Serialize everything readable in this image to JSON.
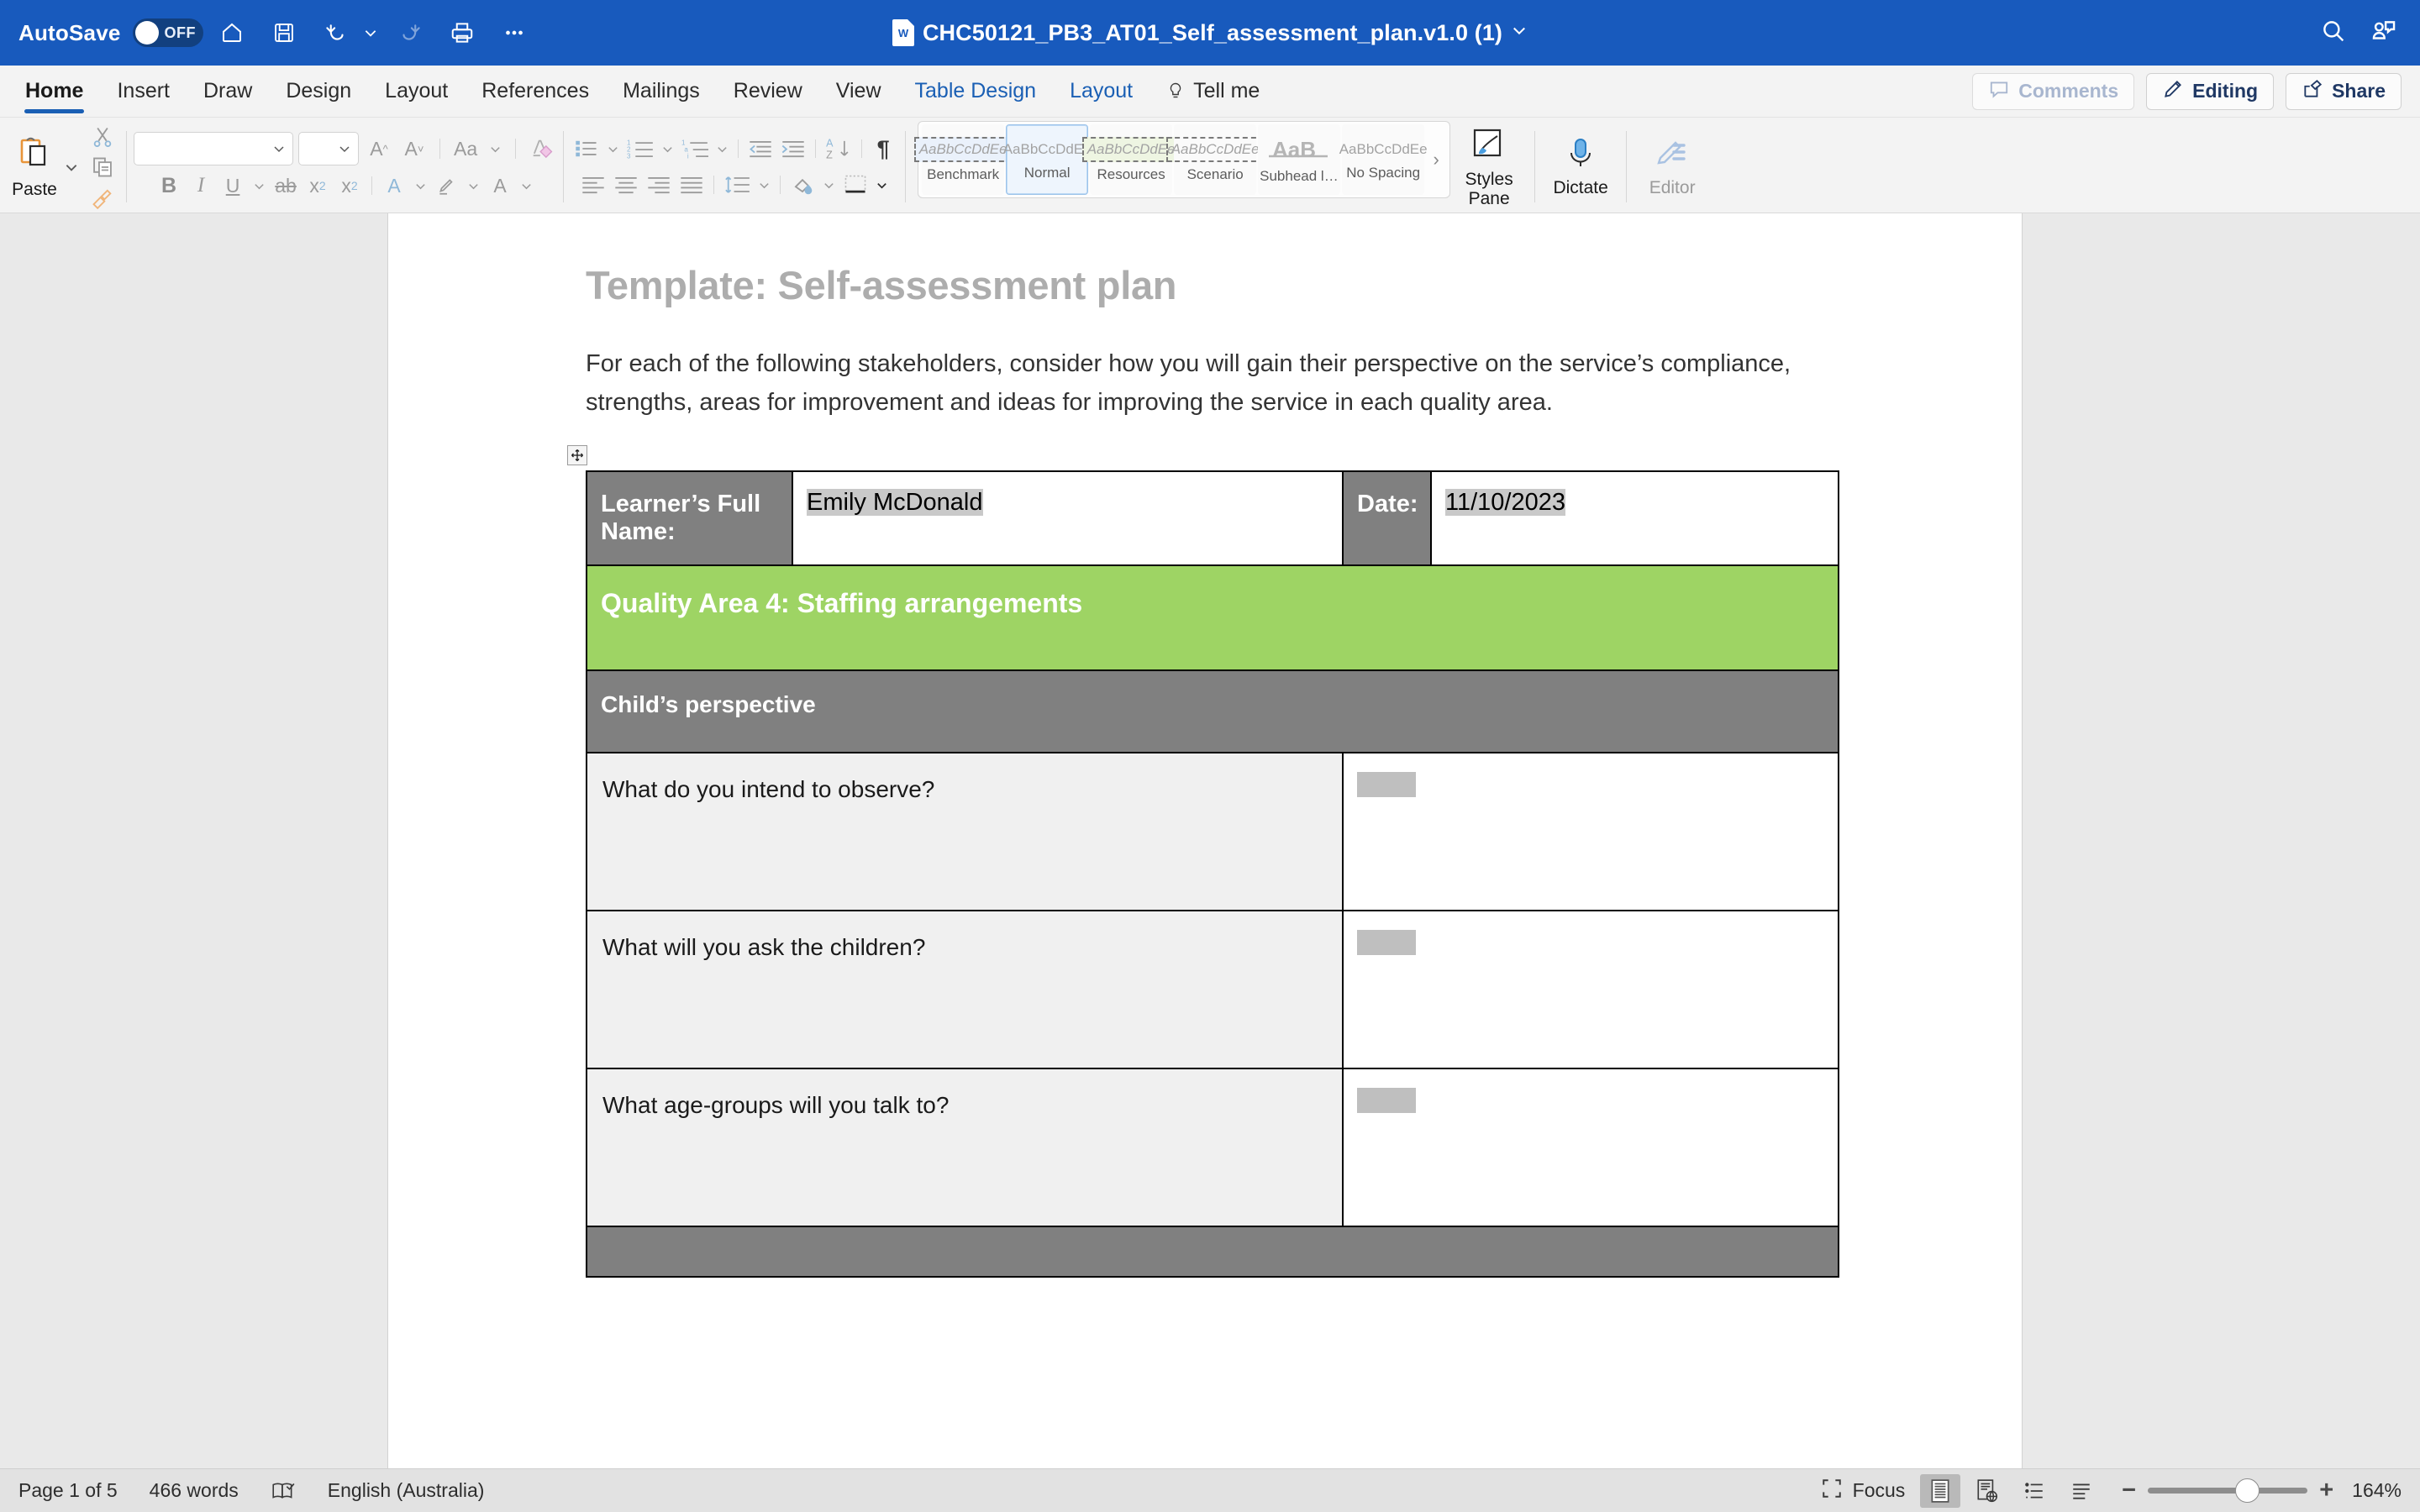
{
  "titlebar": {
    "autosave_label": "AutoSave",
    "autosave_state": "OFF",
    "document_title": "CHC50121_PB3_AT01_Self_assessment_plan.v1.0 (1)",
    "quick_access": [
      {
        "name": "home-icon",
        "label": "Home"
      },
      {
        "name": "save-icon",
        "label": "Save"
      },
      {
        "name": "undo-icon",
        "label": "Undo"
      },
      {
        "name": "undo-dropdown-caret-icon",
        "label": "Undo options"
      },
      {
        "name": "redo-icon",
        "label": "Redo"
      },
      {
        "name": "print-icon",
        "label": "Print"
      },
      {
        "name": "more-commands-icon",
        "label": "More"
      }
    ],
    "right_icons": [
      {
        "name": "search-icon",
        "label": "Search"
      },
      {
        "name": "collaborators-icon",
        "label": "Collaborators"
      }
    ],
    "title_dropdown_caret": "∨",
    "doc_icon_letter": "W"
  },
  "ribbon": {
    "tabs": [
      {
        "label": "Home",
        "active": true,
        "contextual": false
      },
      {
        "label": "Insert",
        "active": false,
        "contextual": false
      },
      {
        "label": "Draw",
        "active": false,
        "contextual": false
      },
      {
        "label": "Design",
        "active": false,
        "contextual": false
      },
      {
        "label": "Layout",
        "active": false,
        "contextual": false
      },
      {
        "label": "References",
        "active": false,
        "contextual": false
      },
      {
        "label": "Mailings",
        "active": false,
        "contextual": false
      },
      {
        "label": "Review",
        "active": false,
        "contextual": false
      },
      {
        "label": "View",
        "active": false,
        "contextual": false
      },
      {
        "label": "Table Design",
        "active": false,
        "contextual": true
      },
      {
        "label": "Layout",
        "active": false,
        "contextual": true
      },
      {
        "label": "Tell me",
        "active": false,
        "contextual": false
      }
    ],
    "actions": [
      {
        "label": "Comments",
        "name": "comments-button",
        "disabled": true
      },
      {
        "label": "Editing",
        "name": "editing-button",
        "disabled": false
      },
      {
        "label": "Share",
        "name": "share-button",
        "disabled": false
      }
    ],
    "clipboard": {
      "paste_label": "Paste",
      "cut_label": "Cut",
      "copy_label": "Copy",
      "format_painter_label": "Format Painter"
    },
    "font": {
      "font_name_value": "",
      "font_name_placeholder": "",
      "font_size_value": "",
      "font_size_placeholder": "",
      "grow_label": "A",
      "shrink_label": "A",
      "change_case_label": "Aa",
      "clear_formatting_label": "A",
      "bold_label": "B",
      "italic_label": "I",
      "underline_label": "U",
      "strikethrough_label": "ab",
      "subscript_label": "x",
      "superscript_label": "x",
      "text_effects_label": "A",
      "highlight_label": "",
      "font_color_label": "A"
    },
    "styles": {
      "more_caret": "›",
      "items": [
        {
          "preview": "AaBbCcDdEe",
          "label": "Benchmark",
          "selected": false,
          "variant": "dashed it blue"
        },
        {
          "preview": "AaBbCcDdEe",
          "label": "Normal",
          "selected": true,
          "variant": ""
        },
        {
          "preview": "AaBbCcDdEe",
          "label": "Resources",
          "selected": false,
          "variant": "dashed it green"
        },
        {
          "preview": "AaBbCcDdEe",
          "label": "Scenario",
          "selected": false,
          "variant": "dashed it"
        },
        {
          "preview": "",
          "label": "Subhead lev...",
          "selected": false,
          "variant": "glyph"
        },
        {
          "preview": "AaBbCcDdEe",
          "label": "No Spacing",
          "selected": false,
          "variant": ""
        }
      ]
    },
    "right_tools": [
      {
        "label": "Styles\nPane",
        "name": "styles-pane-button",
        "disabled": false
      },
      {
        "label": "Dictate",
        "name": "dictate-button",
        "disabled": false
      },
      {
        "label": "Editor",
        "name": "editor-button",
        "disabled": true
      }
    ]
  },
  "document": {
    "heading": "Template: Self-assessment plan",
    "paragraph": "For each of the following stakeholders, consider how you will gain their perspective on the service’s compliance, strengths, areas for improvement and ideas for improving the service in each quality area.",
    "table": {
      "learner_label": "Learner’s Full Name:",
      "learner_value": "Emily McDonald",
      "date_label": "Date:",
      "date_value": "11/10/2023",
      "quality_area": "Quality Area 4: Staffing arrangements",
      "section": "Child’s perspective",
      "rows": [
        {
          "question": "What do you intend to observe?",
          "answer": ""
        },
        {
          "question": "What will you ask the children?",
          "answer": ""
        },
        {
          "question": "What age-groups will you talk to?",
          "answer": ""
        }
      ]
    }
  },
  "statusbar": {
    "page": "Page 1 of 5",
    "words": "466 words",
    "proofing_icon": "proofing-icon",
    "language": "English (Australia)",
    "focus_label": "Focus",
    "views": [
      {
        "name": "print-layout-view-button",
        "active": true
      },
      {
        "name": "web-layout-view-button",
        "active": false
      },
      {
        "name": "outline-view-button",
        "active": false
      },
      {
        "name": "draft-view-button",
        "active": false
      }
    ],
    "zoom_out": "−",
    "zoom_in": "+",
    "zoom_level": "164%"
  },
  "colors": {
    "titlebar_blue": "#185ABD",
    "accent_blue": "#1a5fb4",
    "quality_area_green": "#9ed464",
    "header_gray": "#808080",
    "question_cell_gray": "#f0f0f0",
    "highlight_gray": "#c9c9c9"
  }
}
